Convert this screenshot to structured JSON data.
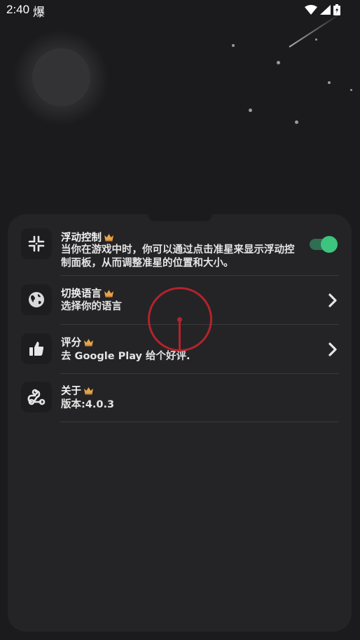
{
  "status_bar": {
    "time": "2:40",
    "app_icon_glyph": "爆",
    "icons": [
      "wifi-icon",
      "signal-icon",
      "battery-icon"
    ]
  },
  "settings": [
    {
      "id": "floating-control",
      "icon": "crosshair-arrows-icon",
      "title": "浮动控制",
      "description": "当你在游戏中时，你可以通过点击准星来显示浮动控制面板，从而调整准星的位置和大小。",
      "control": "toggle",
      "toggle_on": true
    },
    {
      "id": "switch-language",
      "icon": "globe-icon",
      "title": "切换语言",
      "description": "选择你的语言",
      "control": "chevron"
    },
    {
      "id": "rate",
      "icon": "thumbs-up-icon",
      "title": "评分",
      "description": "去 Google Play 给个好评.",
      "control": "chevron"
    },
    {
      "id": "about",
      "icon": "webhook-icon",
      "title": "关于",
      "description": "版本:4.0.3",
      "control": "none"
    }
  ],
  "colors": {
    "background": "#1b1b1d",
    "card": "#242426",
    "toggle_on": "#3dc47e",
    "crosshair": "#b3232b",
    "crown": "#e7a44a"
  }
}
